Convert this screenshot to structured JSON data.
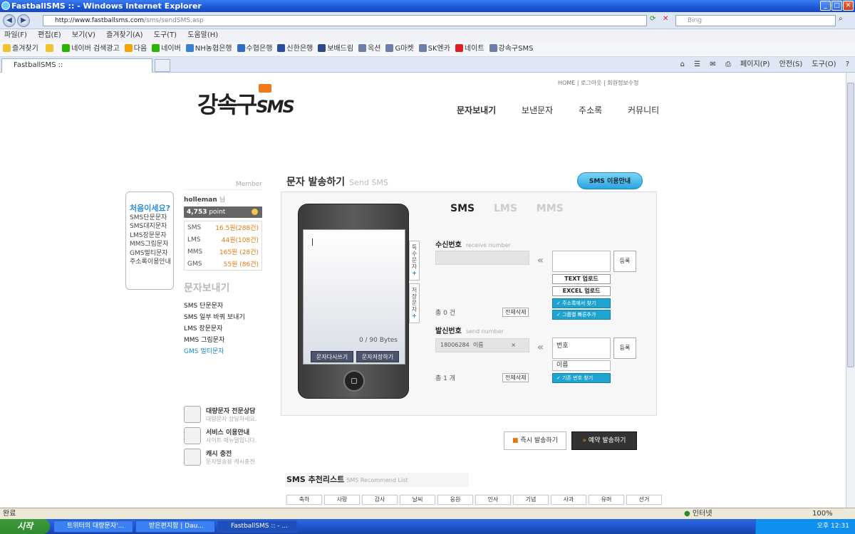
{
  "window": {
    "title": "FastballSMS :: - Windows Internet Explorer"
  },
  "browser": {
    "url": "http://www.fastballsms.com/sms/sendSMS.asp",
    "url_domain": "http://www.fastballsms.com",
    "url_path": "/sms/sendSMS.asp",
    "search_placeholder": "Bing",
    "menu": [
      "파일(F)",
      "편집(E)",
      "보기(V)",
      "즐겨찾기(A)",
      "도구(T)",
      "도움말(H)"
    ],
    "favorites_label": "즐겨찾기",
    "favorites": [
      {
        "label": "네이버 검색광고",
        "color": "#2db400"
      },
      {
        "label": "다음",
        "color": "#f4a300"
      },
      {
        "label": "네이버",
        "color": "#2db400"
      },
      {
        "label": "NH농협은행",
        "color": "#3a7fd0"
      },
      {
        "label": "수협은행",
        "color": "#2c6fbf"
      },
      {
        "label": "신한은행",
        "color": "#2a4f9a"
      },
      {
        "label": "보배드림",
        "color": "#2f4a8a"
      },
      {
        "label": "옥션",
        "color": "#6b7fa8"
      },
      {
        "label": "G마켓",
        "color": "#6b7fa8"
      },
      {
        "label": "SK엔카",
        "color": "#6b7fa8"
      },
      {
        "label": "네이트",
        "color": "#e02020"
      },
      {
        "label": "강속구SMS",
        "color": "#6b7fa8"
      }
    ],
    "tab_title": "FastballSMS ::",
    "commands": [
      "페이지(P)",
      "안전(S)",
      "도구(O)"
    ]
  },
  "site": {
    "logo_text": "강속구",
    "logo_sms": "SMS",
    "top_links": "HOME | 로그아웃 | 회원정보수정",
    "nav": [
      "문자보내기",
      "보낸문자",
      "주소록",
      "커뮤니티"
    ]
  },
  "promo": {
    "title": "처음이세요?",
    "items": [
      "SMS단문문자",
      "SMS대지문자",
      "LMS장문문자",
      "MMS그림문자",
      "GMS멀티문자",
      "주소록이용안내"
    ]
  },
  "member": {
    "header": "Member",
    "username": "holleman",
    "username_suffix": "님",
    "points": "4,753",
    "points_unit": "point",
    "prices": [
      {
        "type": "SMS",
        "price": "16.5원(288건)"
      },
      {
        "type": "LMS",
        "price": "44원(108건)"
      },
      {
        "type": "MMS",
        "price": "165원 (28건)"
      },
      {
        "type": "GMS",
        "price": "55원 (86건)"
      }
    ]
  },
  "left_menu": {
    "heading": "문자보내기",
    "items": [
      "SMS 단문문자",
      "SMS 일부 바꿔 보내기",
      "LMS 장문문자",
      "MMS 그림문자",
      "GMS 멀티문자"
    ],
    "active_index": 4
  },
  "services": [
    {
      "title": "대량문자 전문상담",
      "sub": "대량문자 상담하세요."
    },
    {
      "title": "서비스 이용안내",
      "sub": "사이트 매뉴얼입니다."
    },
    {
      "title": "캐시 충전",
      "sub": "문자발송용 캐시충전"
    }
  ],
  "send": {
    "title": "문자 발송하기",
    "title_en": "Send SMS",
    "guide_button": "SMS 이용안내",
    "msg_types": [
      "SMS",
      "LMS",
      "MMS"
    ],
    "active_type": "SMS",
    "bytes": "0 / 90 Bytes",
    "rewrite_button": "문자다시쓰기",
    "save_button": "문자저장하기",
    "side_special": "특수문자",
    "side_saved": "저장문자",
    "receive_label": "수신번호",
    "receive_label_en": "receive number",
    "receive_count": "총 0 건",
    "clear_all": "전체삭제",
    "register": "등록",
    "text_upload": "TEXT 업로드",
    "excel_upload": "EXCEL 업로드",
    "addressbook_find": "주소록에서 찾기",
    "group_add": "그룹별 빠른추가",
    "sender_label": "발신번호",
    "sender_label_en": "send number",
    "sender_number": "18006284",
    "sender_name": "이름",
    "sender_remove": "×",
    "sender_input_placeholder": "번호",
    "sender_name_placeholder": "이름",
    "sender_count": "총 1 개",
    "existing_number": "기존 번호 찾기",
    "send_now": "즉시 발송하기",
    "send_reserved": "예약 발송하기"
  },
  "recommend": {
    "title": "SMS 추천리스트",
    "title_en": "SMS Recommend List",
    "categories": [
      "축하",
      "사랑",
      "감사",
      "날씨",
      "응원",
      "인사",
      "기념",
      "사과",
      "유머",
      "선거"
    ]
  },
  "status": {
    "left": "완료",
    "zone": "인터넷",
    "zoom": "100%"
  },
  "taskbar": {
    "start": "시작",
    "tasks": [
      "트위터의 대량문자'...",
      "받은편지함 | Dau...",
      "FastballSMS :: - ..."
    ],
    "clock": "오후 12:31"
  }
}
